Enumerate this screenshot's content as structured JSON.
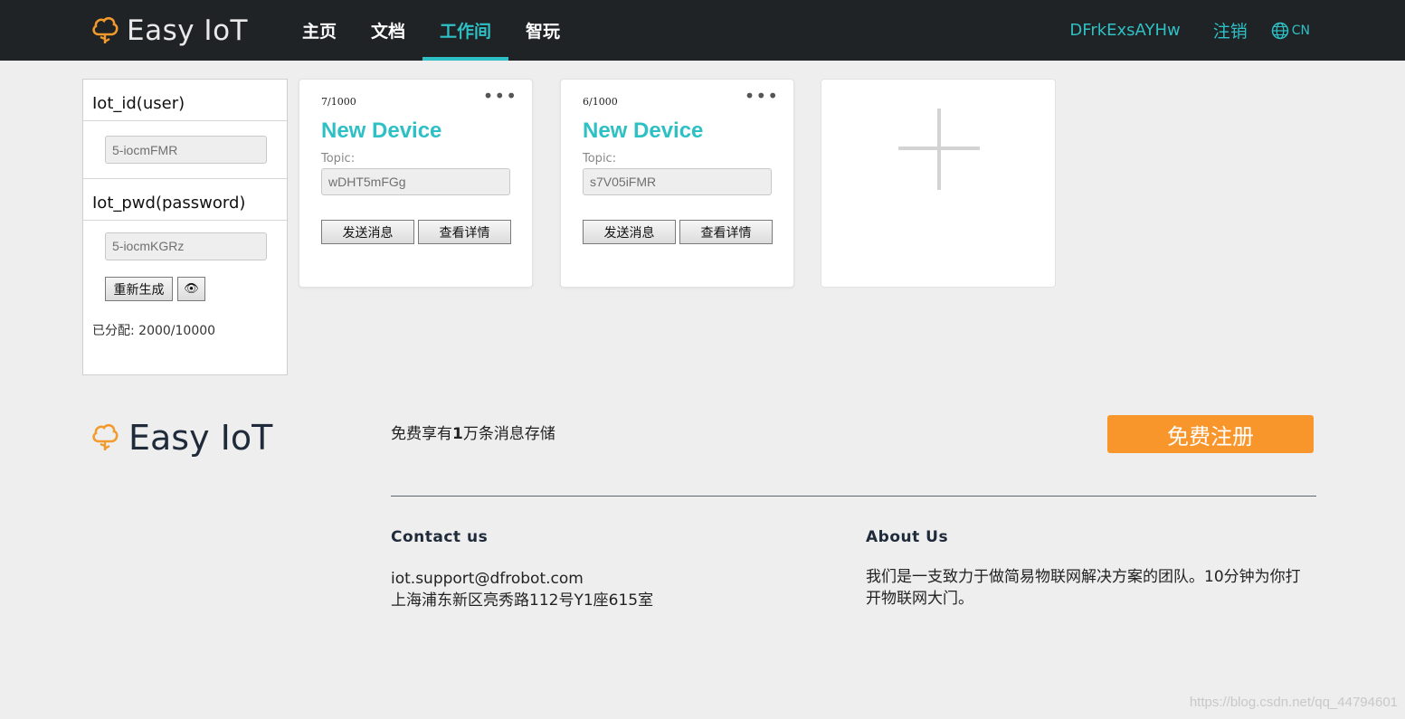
{
  "header": {
    "brand": "Easy IoT",
    "nav": [
      {
        "label": "主页",
        "active": false
      },
      {
        "label": "文档",
        "active": false
      },
      {
        "label": "工作间",
        "active": true
      },
      {
        "label": "智玩",
        "active": false
      }
    ],
    "username": "DFrkExsAYHw",
    "logout_label": "注销",
    "language": "CN",
    "accent_color": "#2ec0c4",
    "background_color": "#1f2326"
  },
  "credentials": {
    "user_label": "Iot_id(user)",
    "user_value": "5-iocmFMR",
    "pwd_label": "Iot_pwd(password)",
    "pwd_value": "5-iocmKGRz",
    "regenerate_label": "重新生成",
    "show_icon": "eye-icon",
    "allocation_label": "已分配:",
    "allocation_value": "2000/10000"
  },
  "devices": [
    {
      "count": "7/1000",
      "name": "New Device",
      "topic_label": "Topic:",
      "topic": "wDHT5mFGg",
      "send_label": "发送消息",
      "details_label": "查看详情"
    },
    {
      "count": "6/1000",
      "name": "New Device",
      "topic_label": "Topic:",
      "topic": "s7V05iFMR",
      "send_label": "发送消息",
      "details_label": "查看详情"
    }
  ],
  "add_device_icon": "plus-icon",
  "footer": {
    "brand": "Easy IoT",
    "promo_prefix": "免费享有",
    "promo_number": "1",
    "promo_suffix": "万条消息存储",
    "register_label": "免费注册",
    "register_color": "#f9962b",
    "contact_title": "Contact us",
    "contact_email": "iot.support@dfrobot.com",
    "contact_address": "上海浦东新区亮秀路112号Y1座615室",
    "about_title": "About Us",
    "about_text": "我们是一支致力于做简易物联网解决方案的团队。10分钟为你打开物联网大门。"
  },
  "watermark": "https://blog.csdn.net/qq_44794601"
}
